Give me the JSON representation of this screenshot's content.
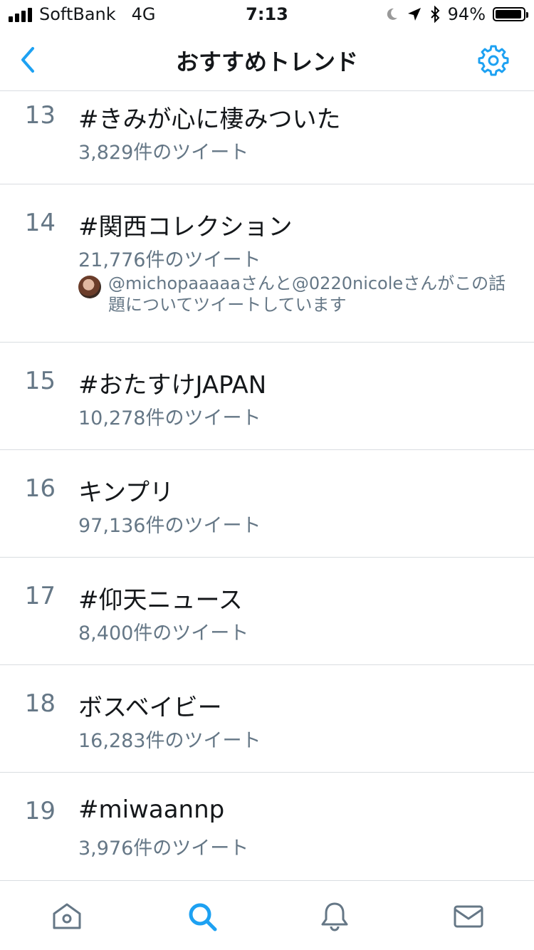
{
  "status_bar": {
    "carrier": "SoftBank",
    "network": "4G",
    "time": "7:13",
    "battery": "94%",
    "battery_level": 0.94
  },
  "nav": {
    "title": "おすすめトレンド"
  },
  "trends": [
    {
      "rank": "13",
      "name": "#きみが心に棲みついた",
      "count": "3,829件のツイート"
    },
    {
      "rank": "14",
      "name": "#関西コレクション",
      "count": "21,776件のツイート",
      "context": "@michopaaaaaさんと@0220nicoleさんがこの話題についてツイートしています"
    },
    {
      "rank": "15",
      "name": "#おたすけJAPAN",
      "count": "10,278件のツイート"
    },
    {
      "rank": "16",
      "name": "キンプリ",
      "count": "97,136件のツイート"
    },
    {
      "rank": "17",
      "name": "#仰天ニュース",
      "count": "8,400件のツイート"
    },
    {
      "rank": "18",
      "name": "ボスベイビー",
      "count": "16,283件のツイート"
    },
    {
      "rank": "19",
      "name": "#miwaannp",
      "count": "3,976件のツイート"
    }
  ],
  "tabs": [
    {
      "icon": "home-icon",
      "active": false
    },
    {
      "icon": "search-icon",
      "active": true
    },
    {
      "icon": "bell-icon",
      "active": false
    },
    {
      "icon": "mail-icon",
      "active": false
    }
  ],
  "colors": {
    "accent": "#1da1f2",
    "text_secondary": "#657786",
    "divider": "#d9dde1",
    "icon_inactive": "#657786"
  }
}
